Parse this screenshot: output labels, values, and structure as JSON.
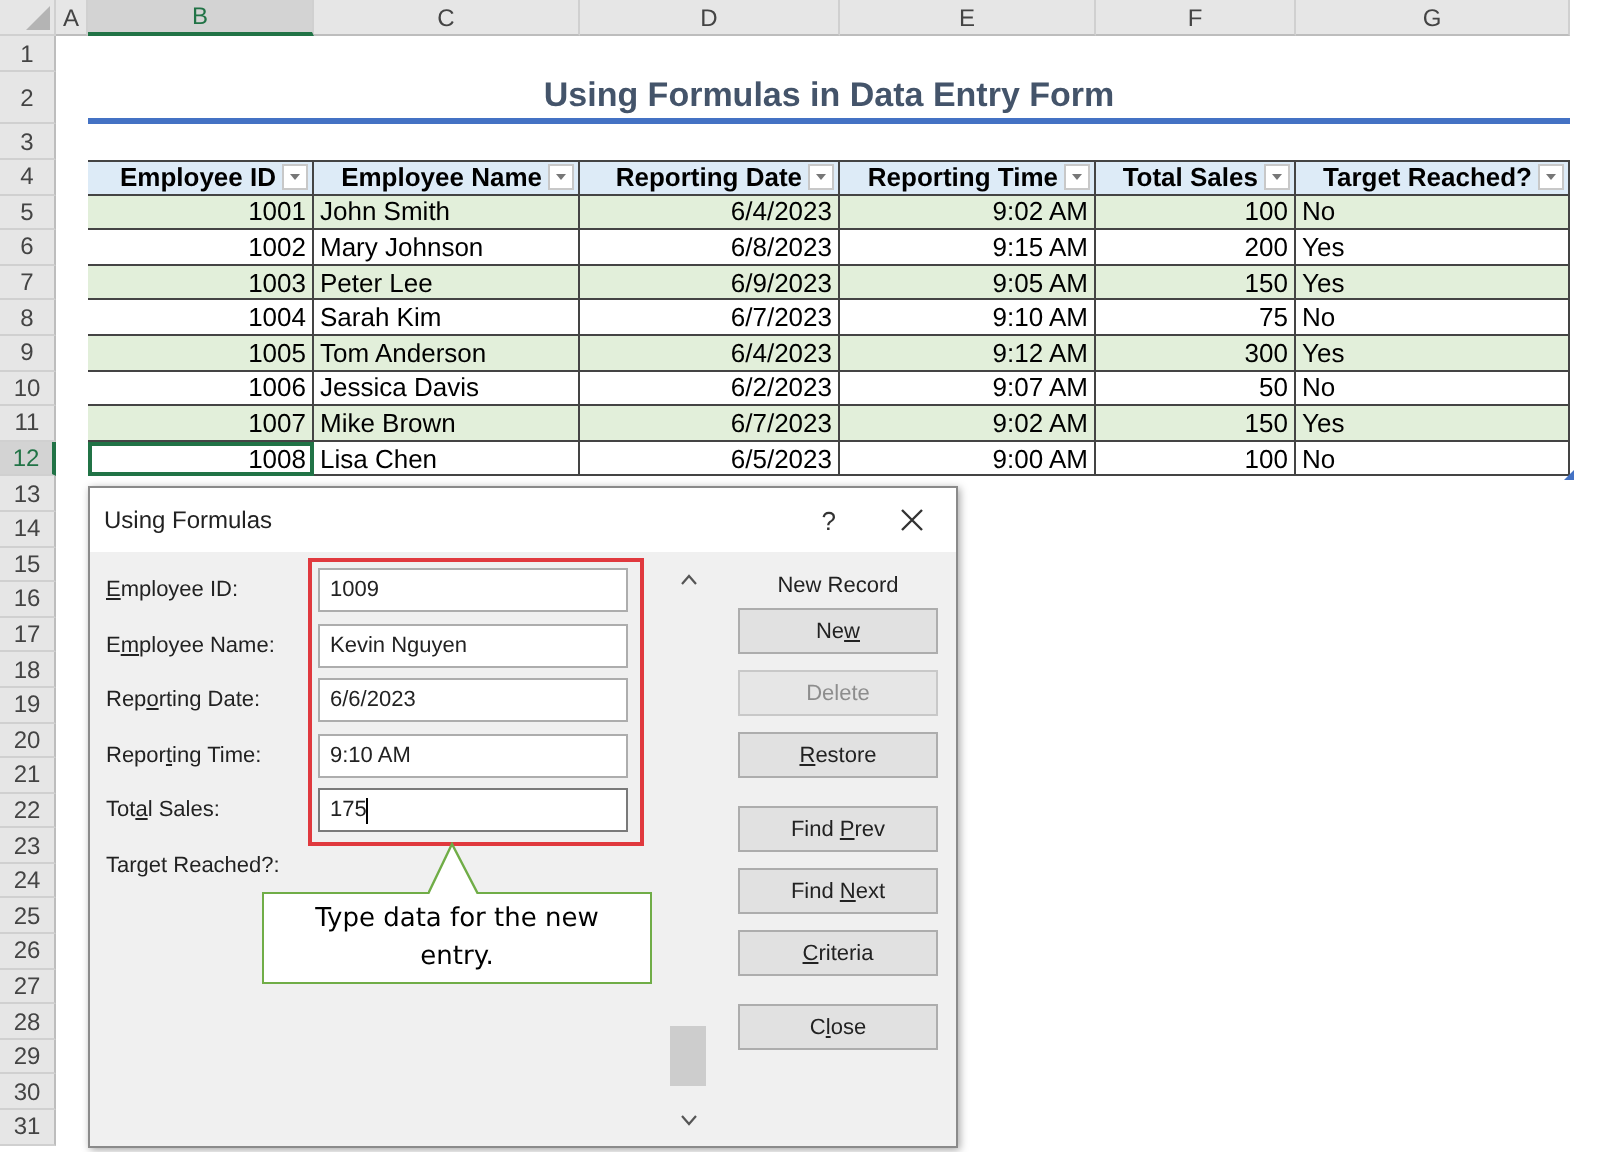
{
  "sheet": {
    "columns": [
      {
        "label": "A",
        "selected": false
      },
      {
        "label": "B",
        "selected": true
      },
      {
        "label": "C",
        "selected": false
      },
      {
        "label": "D",
        "selected": false
      },
      {
        "label": "E",
        "selected": false
      },
      {
        "label": "F",
        "selected": false
      },
      {
        "label": "G",
        "selected": false
      }
    ],
    "rows": [
      {
        "label": "1",
        "selected": false
      },
      {
        "label": "2",
        "selected": false
      },
      {
        "label": "3",
        "selected": false
      },
      {
        "label": "4",
        "selected": false
      },
      {
        "label": "5",
        "selected": false
      },
      {
        "label": "6",
        "selected": false
      },
      {
        "label": "7",
        "selected": false
      },
      {
        "label": "8",
        "selected": false
      },
      {
        "label": "9",
        "selected": false
      },
      {
        "label": "10",
        "selected": false
      },
      {
        "label": "11",
        "selected": false
      },
      {
        "label": "12",
        "selected": true
      },
      {
        "label": "13",
        "selected": false
      },
      {
        "label": "14",
        "selected": false
      },
      {
        "label": "15",
        "selected": false
      },
      {
        "label": "16",
        "selected": false
      },
      {
        "label": "17",
        "selected": false
      },
      {
        "label": "18",
        "selected": false
      },
      {
        "label": "19",
        "selected": false
      },
      {
        "label": "20",
        "selected": false
      },
      {
        "label": "21",
        "selected": false
      },
      {
        "label": "22",
        "selected": false
      },
      {
        "label": "23",
        "selected": false
      },
      {
        "label": "24",
        "selected": false
      },
      {
        "label": "25",
        "selected": false
      },
      {
        "label": "26",
        "selected": false
      },
      {
        "label": "27",
        "selected": false
      },
      {
        "label": "28",
        "selected": false
      },
      {
        "label": "29",
        "selected": false
      },
      {
        "label": "30",
        "selected": false
      },
      {
        "label": "31",
        "selected": false
      }
    ],
    "title": "Using Formulas in Data Entry Form",
    "table": {
      "columns": [
        {
          "label": "Employee ID",
          "kind": "number"
        },
        {
          "label": "Employee Name",
          "kind": "text"
        },
        {
          "label": "Reporting Date",
          "kind": "number"
        },
        {
          "label": "Reporting Time",
          "kind": "number"
        },
        {
          "label": "Total Sales",
          "kind": "number"
        },
        {
          "label": "Target Reached?",
          "kind": "text"
        }
      ],
      "rows": [
        {
          "cells": [
            "1001",
            "John Smith",
            "6/4/2023",
            "9:02 AM",
            "100",
            "No"
          ]
        },
        {
          "cells": [
            "1002",
            "Mary Johnson",
            "6/8/2023",
            "9:15 AM",
            "200",
            "Yes"
          ]
        },
        {
          "cells": [
            "1003",
            "Peter Lee",
            "6/9/2023",
            "9:05 AM",
            "150",
            "Yes"
          ]
        },
        {
          "cells": [
            "1004",
            "Sarah Kim",
            "6/7/2023",
            "9:10 AM",
            "75",
            "No"
          ]
        },
        {
          "cells": [
            "1005",
            "Tom Anderson",
            "6/4/2023",
            "9:12 AM",
            "300",
            "Yes"
          ]
        },
        {
          "cells": [
            "1006",
            "Jessica Davis",
            "6/2/2023",
            "9:07 AM",
            "50",
            "No"
          ]
        },
        {
          "cells": [
            "1007",
            "Mike Brown",
            "6/7/2023",
            "9:02 AM",
            "150",
            "Yes"
          ]
        },
        {
          "cells": [
            "1008",
            "Lisa Chen",
            "6/5/2023",
            "9:00 AM",
            "100",
            "No"
          ]
        }
      ]
    }
  },
  "dialog": {
    "title": "Using Formulas",
    "help": "?",
    "fields": [
      {
        "kind": "input",
        "label": {
          "key": "E",
          "after": "mployee ID:"
        },
        "value": "1009",
        "focused": false
      },
      {
        "kind": "input",
        "label": {
          "before": "E",
          "key": "m",
          "after": "ployee Name:"
        },
        "value": "Kevin Nguyen",
        "focused": false
      },
      {
        "kind": "input",
        "label": {
          "before": "Rep",
          "key": "o",
          "after": "rting Date:"
        },
        "value": "6/6/2023",
        "focused": false
      },
      {
        "kind": "input",
        "label": {
          "before": "Repor",
          "key": "t",
          "after": "ing Time:"
        },
        "value": "9:10 AM",
        "focused": false
      },
      {
        "kind": "input",
        "label": {
          "before": "Tot",
          "key": "a",
          "after": "l Sales:"
        },
        "value": "175",
        "focused": true
      },
      {
        "kind": "computed",
        "label": {
          "before": "Target Reached?:"
        }
      }
    ],
    "record_status": "New Record",
    "buttons": [
      {
        "label": {
          "before": "Ne",
          "key": "w"
        },
        "disabled": false
      },
      {
        "label": {
          "before": "Delete"
        },
        "disabled": true
      },
      {
        "label": {
          "key": "R",
          "after": "estore"
        },
        "disabled": false
      },
      {
        "label": {
          "before": "Find ",
          "key": "P",
          "after": "rev"
        },
        "disabled": false
      },
      {
        "label": {
          "before": "Find ",
          "key": "N",
          "after": "ext"
        },
        "disabled": false
      },
      {
        "label": {
          "key": "C",
          "after": "riteria"
        },
        "disabled": false
      },
      {
        "label": {
          "before": "C",
          "key": "l",
          "after": "ose"
        },
        "disabled": false
      }
    ],
    "callout": "Type data for the new entry."
  }
}
